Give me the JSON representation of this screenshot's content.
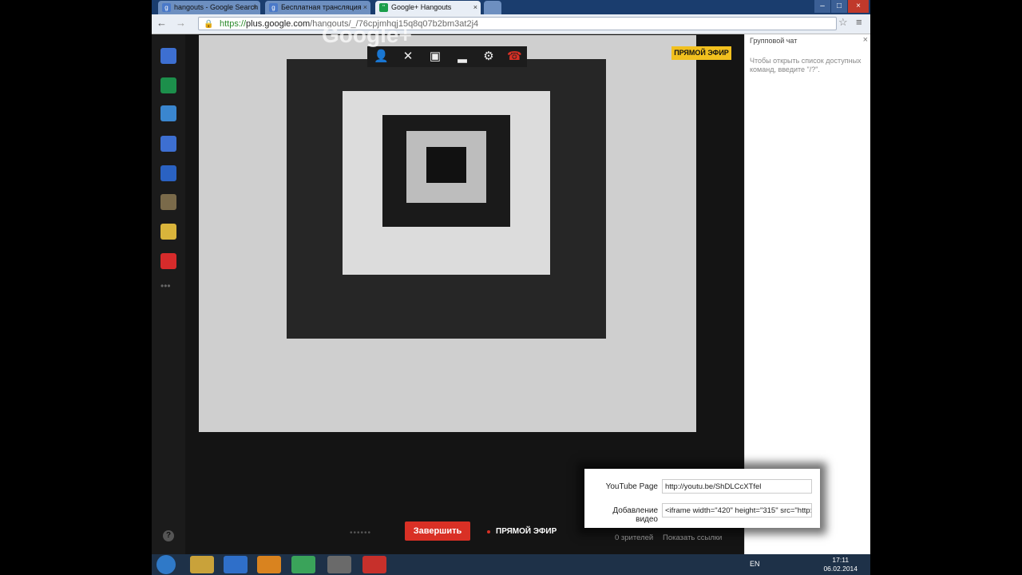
{
  "browser": {
    "tabs": [
      {
        "label": "hangouts - Google Search",
        "favicon": "g-icon"
      },
      {
        "label": "Бесплатная трансляция",
        "favicon": "g-icon"
      },
      {
        "label": "Google+ Hangouts",
        "favicon": "hangouts-icon"
      }
    ],
    "url_scheme": "https://",
    "url_host": "plus.google.com",
    "url_path": "/hangouts/_/76cpjmhqj15q8q07b2bm3at2j4",
    "window_controls": [
      "minimize",
      "maximize",
      "close"
    ]
  },
  "hangout": {
    "on_air_badge": "ПРЯМОЙ ЭФИР",
    "end_button": "Завершить",
    "live_label": "ПРЯМОЙ ЭФИР",
    "viewers": "0 зрителей",
    "show_links": "Показать ссылки",
    "left_rail_icons": [
      "chat-icon",
      "share-icon",
      "qa-icon",
      "camera-icon",
      "video-icon",
      "toolbox-icon",
      "effects-icon",
      "youtube-icon",
      "more-icon"
    ],
    "top_controls": [
      "add-person-icon",
      "mute-mic-icon",
      "camera-off-icon",
      "bandwidth-icon",
      "settings-icon",
      "hangup-icon"
    ],
    "logo_text": "Google+"
  },
  "chat": {
    "title": "Групповой чат",
    "hint": "Чтобы открыть список доступных команд, введите \"/?\"."
  },
  "embed_panel": {
    "youtube_label": "YouTube Page",
    "youtube_value": "http://youtu.be/ShDLCcXTfel",
    "embed_label": "Добавление видео",
    "embed_value": "<iframe width=\"420\" height=\"315\" src=\"http://"
  },
  "taskbar": {
    "apps": [
      "explorer-icon",
      "ie-icon",
      "media-player-icon",
      "chrome-icon",
      "tool-icon",
      "acrobat-icon"
    ],
    "lang": "EN",
    "time": "17:11",
    "date": "06.02.2014"
  }
}
